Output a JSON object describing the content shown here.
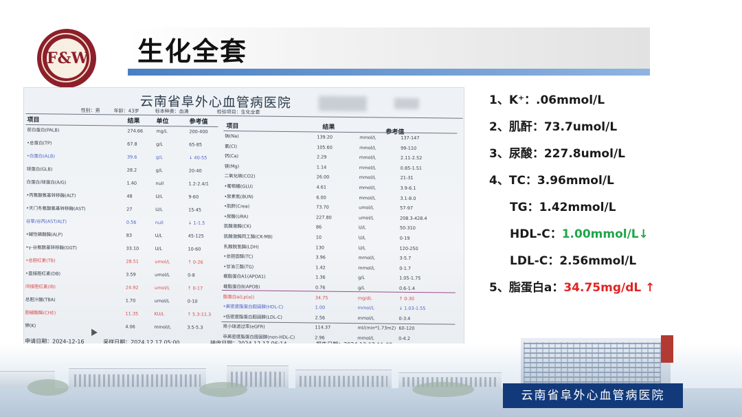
{
  "slide": {
    "title": "生化全套",
    "logo_mark": "F&W"
  },
  "findings": [
    {
      "number": "1、",
      "label": "K⁺：",
      "value": ".06mmol/L",
      "flag": ""
    },
    {
      "number": "2、",
      "label": "肌酐：",
      "value": "73.7umol/L",
      "flag": ""
    },
    {
      "number": "3、",
      "label": "尿酸：",
      "value": "227.8umol/L",
      "flag": ""
    },
    {
      "number": "4、",
      "label": "TC：",
      "value": "3.96mmol/L",
      "flag": ""
    },
    {
      "number": "",
      "label": "TG：",
      "value": "1.42mmol/L",
      "flag": ""
    },
    {
      "number": "",
      "label": "HDL-C：",
      "value": "1.00mmol/L↓",
      "flag": "low"
    },
    {
      "number": "",
      "label": "LDL-C：",
      "value": "2.56mmol/L",
      "flag": ""
    },
    {
      "number": "5、",
      "label": "脂蛋白a：",
      "value": "34.75mg/dL ↑",
      "flag": "high"
    }
  ],
  "report": {
    "hospital": "云南省阜外心血管病医院",
    "gender": "性别：男",
    "age": "年龄：43岁",
    "sample_type": "标本种类：血清",
    "test_item": "检验项目：生化全套",
    "left_headers": [
      "项目",
      "结果",
      "单位",
      "参考值"
    ],
    "right_headers": [
      "项目",
      "结果",
      "参考值"
    ],
    "left_rows": [
      {
        "name": "前白蛋白(PALB)",
        "result": "274.66",
        "unit": "mg/L",
        "ref": "200-400",
        "style": ""
      },
      {
        "name": "•总蛋白(TP)",
        "result": "67.8",
        "unit": "g/L",
        "ref": "65-85",
        "style": ""
      },
      {
        "name": "•白蛋白(ALB)",
        "result": "39.6",
        "unit": "g/L",
        "ref": "↓ 40-55",
        "style": "blue"
      },
      {
        "name": "球蛋白(GLB)",
        "result": "28.2",
        "unit": "g/L",
        "ref": "20-40",
        "style": ""
      },
      {
        "name": "白蛋白/球蛋白(A/G)",
        "result": "1.40",
        "unit": "null",
        "ref": "1.2-2.4/1",
        "style": ""
      },
      {
        "name": "•丙氨酸氨基转移酶(ALT)",
        "result": "48",
        "unit": "U/L",
        "ref": "9-60",
        "style": ""
      },
      {
        "name": "•天门冬氨酸氨基转移酶(AST)",
        "result": "27",
        "unit": "U/L",
        "ref": "15-45",
        "style": ""
      },
      {
        "name": "谷草/谷丙(AST/ALT)",
        "result": "0.56",
        "unit": "null",
        "ref": "↓ 1-1.5",
        "style": "blue"
      },
      {
        "name": "•碱性磷酸酶(ALP)",
        "result": "83",
        "unit": "U/L",
        "ref": "45-125",
        "style": ""
      },
      {
        "name": "•γ-谷氨酰基转移酶(GGT)",
        "result": "33.10",
        "unit": "U/L",
        "ref": "10-60",
        "style": ""
      },
      {
        "name": "•总胆红素(TB)",
        "result": "28.51",
        "unit": "umol/L",
        "ref": "↑ 0-26",
        "style": "red"
      },
      {
        "name": "•直接胆红素(DB)",
        "result": "3.59",
        "unit": "umol/L",
        "ref": "0-8",
        "style": ""
      },
      {
        "name": "间接胆红素(IB)",
        "result": "24.92",
        "unit": "umol/L",
        "ref": "↑ 0-17",
        "style": "red"
      },
      {
        "name": "总胆汁酸(TBA)",
        "result": "1.70",
        "unit": "umol/L",
        "ref": "0-10",
        "style": ""
      },
      {
        "name": "胆碱酯酶(CHE)",
        "result": "11.35",
        "unit": "KU/L",
        "ref": "↑ 5.3-11.3",
        "style": "red"
      },
      {
        "name": "钾(K)",
        "result": "4.06",
        "unit": "mmol/L",
        "ref": "3.5-5.3",
        "style": ""
      }
    ],
    "right_rows": [
      {
        "name": "钠(Na)",
        "result": "139.20",
        "unit": "mmol/L",
        "ref": "137-147",
        "style": ""
      },
      {
        "name": "氯(Cl)",
        "result": "105.60",
        "unit": "mmol/L",
        "ref": "99-110",
        "style": ""
      },
      {
        "name": "钙(Ca)",
        "result": "2.29",
        "unit": "mmol/L",
        "ref": "2.11-2.52",
        "style": ""
      },
      {
        "name": "镁(Mg)",
        "result": "1.14",
        "unit": "mmol/L",
        "ref": "0.85-1.51",
        "style": ""
      },
      {
        "name": "二氧化碳(CO2)",
        "result": "26.00",
        "unit": "mmol/L",
        "ref": "21-31",
        "style": ""
      },
      {
        "name": "•葡萄糖(GLU)",
        "result": "4.61",
        "unit": "mmol/L",
        "ref": "3.9-6.1",
        "style": ""
      },
      {
        "name": "•尿素氮(BUN)",
        "result": "6.00",
        "unit": "mmol/L",
        "ref": "3.1-8.0",
        "style": ""
      },
      {
        "name": "•肌酐(Crea)",
        "result": "73.70",
        "unit": "umol/L",
        "ref": "57-97",
        "style": ""
      },
      {
        "name": "•尿酸(URA)",
        "result": "227.80",
        "unit": "umol/L",
        "ref": "208.3-428.4",
        "style": ""
      },
      {
        "name": "肌酸激酶(CK)",
        "result": "86",
        "unit": "U/L",
        "ref": "50-310",
        "style": ""
      },
      {
        "name": "肌酸激酶同工酶(CK-MB)",
        "result": "10",
        "unit": "U/L",
        "ref": "0-19",
        "style": ""
      },
      {
        "name": "乳酸脱氢酶(LDH)",
        "result": "130",
        "unit": "U/L",
        "ref": "120-250",
        "style": ""
      },
      {
        "name": "•总胆固醇(TC)",
        "result": "3.96",
        "unit": "mmol/L",
        "ref": "3-5.7",
        "style": ""
      },
      {
        "name": "•甘油三酯(TG)",
        "result": "1.42",
        "unit": "mmol/L",
        "ref": "0-1.7",
        "style": ""
      },
      {
        "name": "载脂蛋白A1(APOA1)",
        "result": "1.36",
        "unit": "g/L",
        "ref": "1.05-1.75",
        "style": ""
      },
      {
        "name": "载脂蛋白B(APOB)",
        "result": "0.76",
        "unit": "g/L",
        "ref": "0.6-1.4",
        "style": ""
      },
      {
        "name": "脂蛋白a(Lp(a))",
        "result": "34.75",
        "unit": "mg/dL",
        "ref": "↑ 0-30",
        "style": "red"
      },
      {
        "name": "•高密度脂蛋白胆固醇(HDL-C)",
        "result": "1.00",
        "unit": "mmol/L",
        "ref": "↓ 1.03-1.55",
        "style": "blue"
      },
      {
        "name": "•低密度脂蛋白胆固醇(LDL-C)",
        "result": "2.56",
        "unit": "mmol/L",
        "ref": "0-3.4",
        "style": ""
      },
      {
        "name": "肾小球滤过率(eGFR)",
        "result": "114.37",
        "unit": "ml/(min*1.73m2)",
        "ref": "60-120",
        "style": ""
      },
      {
        "name": "非高密度脂蛋白胆固醇(non-HDL-C)",
        "result": "2.96",
        "unit": "mmol/L",
        "ref": "0-4.2",
        "style": ""
      }
    ],
    "footer": {
      "apply_date": "申请日期：2024-12-16",
      "collect_date": "采样日期：2024.12.17 05:00",
      "receive_date": "接收日期：2024.12.17 06:14",
      "report_date": "报告日期：2024.12.17 11:05"
    }
  },
  "banner": {
    "text": "云南省阜外心血管病医院"
  },
  "colors": {
    "title_underline": "#4a7fc2",
    "banner_bg": "#123a7a",
    "logo": "#8c1f2b",
    "green": "#1fa64a",
    "red": "#e02424"
  }
}
